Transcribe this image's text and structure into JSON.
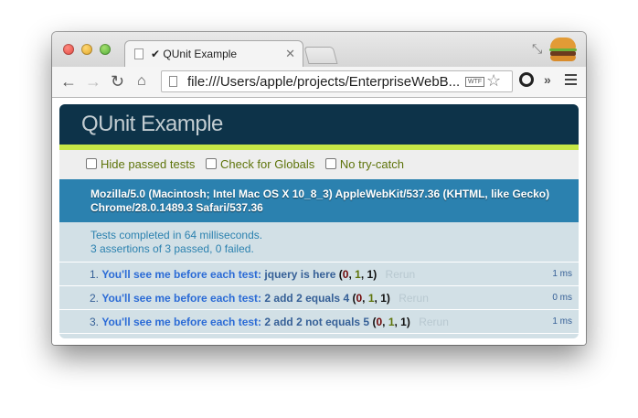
{
  "browser": {
    "tab_title": "✔ QUnit Example",
    "tab_close": "✕",
    "url": "file:///Users/apple/projects/EnterpriseWebB...",
    "wtf_badge": "WTF",
    "star_icon": "☆",
    "more": "»",
    "back": "←",
    "forward": "→",
    "reload": "↻",
    "home": "⌂",
    "shrink": "⤡"
  },
  "qunit": {
    "title": "QUnit Example",
    "toolbar": {
      "hide_passed": "Hide passed tests",
      "check_globals": "Check for Globals",
      "no_try_catch": "No try-catch"
    },
    "user_agent": "Mozilla/5.0 (Macintosh; Intel Mac OS X 10_8_3) AppleWebKit/537.36 (KHTML, like Gecko) Chrome/28.0.1489.3 Safari/537.36",
    "result_line1": "Tests completed in 64 milliseconds.",
    "result_line2": "3 assertions of 3 passed, 0 failed.",
    "tests": [
      {
        "num": "1.",
        "module": "You'll see me before each test:",
        "name": "jquery is here",
        "failed": "0",
        "passed": "1",
        "total": "1",
        "rerun": "Rerun",
        "runtime": "1 ms"
      },
      {
        "num": "2.",
        "module": "You'll see me before each test:",
        "name": "2 add 2 equals 4",
        "failed": "0",
        "passed": "1",
        "total": "1",
        "rerun": "Rerun",
        "runtime": "0 ms"
      },
      {
        "num": "3.",
        "module": "You'll see me before each test:",
        "name": "2 add 2 not equals 5",
        "failed": "0",
        "passed": "1",
        "total": "1",
        "rerun": "Rerun",
        "runtime": "1 ms"
      }
    ]
  }
}
